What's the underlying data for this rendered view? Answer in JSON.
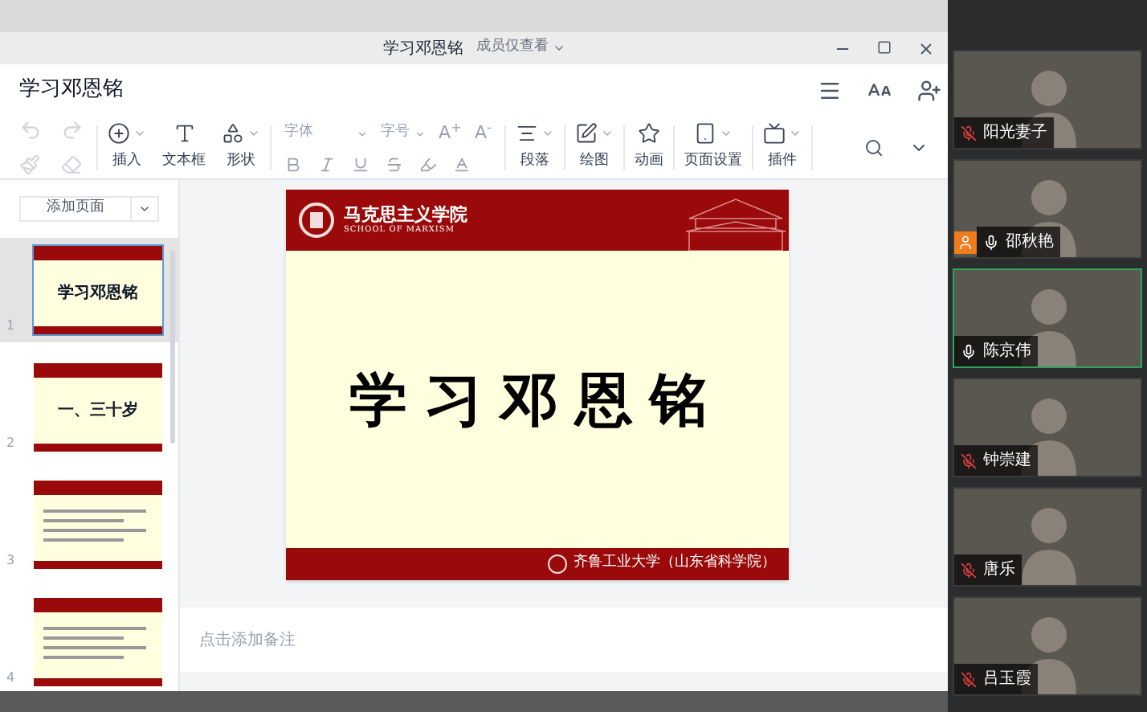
{
  "window": {
    "title": "学习邓恩铭",
    "view_mode": "成员仅查看"
  },
  "document": {
    "title": "学习邓恩铭"
  },
  "toolbar": {
    "groups": [
      {
        "kind": "history"
      },
      {
        "kind": "big",
        "items": [
          {
            "label": "插入",
            "menu": true
          },
          {
            "label": "文本框",
            "menu": false
          },
          {
            "label": "形状",
            "menu": true
          }
        ]
      },
      {
        "kind": "font",
        "disabled": true,
        "font_family": "字体",
        "font_size": "字号",
        "grow": "A$^{+}$",
        "shrink": "A$^{-}$"
      },
      {
        "kind": "big",
        "items": [
          {
            "label": "段落",
            "menu": true
          }
        ]
      },
      {
        "kind": "big",
        "items": [
          {
            "label": "绘图",
            "menu": true
          }
        ]
      },
      {
        "kind": "big",
        "items": [
          {
            "label": "动画",
            "menu": false
          }
        ]
      },
      {
        "kind": "big",
        "items": [
          {
            "label": "页面设置",
            "menu": true
          }
        ]
      },
      {
        "kind": "big",
        "items": [
          {
            "label": "插件",
            "menu": true
          }
        ]
      }
    ]
  },
  "sidebar": {
    "add_button": "添加页面",
    "slides": [
      {
        "number": "1",
        "kind": "title",
        "title": "学习邓恩铭",
        "selected": true
      },
      {
        "number": "2",
        "kind": "title",
        "title": "一、三十岁",
        "selected": false
      },
      {
        "number": "3",
        "kind": "text",
        "selected": false
      },
      {
        "number": "4",
        "kind": "text",
        "selected": false
      }
    ]
  },
  "slide": {
    "school": "马克思主义学院",
    "school_en": "SCHOOL OF MARXISM",
    "title": "学习邓恩铭",
    "footer": "齐鲁工业大学（山东省科学院）"
  },
  "notes": {
    "placeholder": "点击添加备注"
  },
  "participants": [
    {
      "name": "阳光妻子",
      "muted": true,
      "host": false,
      "speaking": false
    },
    {
      "name": "邵秋艳",
      "muted": false,
      "host": true,
      "speaking": false
    },
    {
      "name": "陈京伟",
      "muted": false,
      "host": false,
      "speaking": true
    },
    {
      "name": "钟崇建",
      "muted": true,
      "host": false,
      "speaking": false
    },
    {
      "name": "唐乐",
      "muted": true,
      "host": false,
      "speaking": false
    },
    {
      "name": "吕玉霞",
      "muted": true,
      "host": false,
      "speaking": false
    }
  ]
}
